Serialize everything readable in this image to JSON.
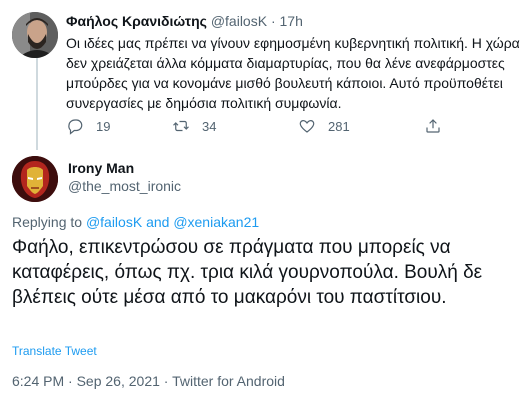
{
  "parent_tweet": {
    "author_name": "Φαήλος Κρανιδιώτης",
    "author_handle": "@failosK",
    "separator": "·",
    "time": "17h",
    "text": "Οι ιδέες μας πρέπει να γίνουν εφημοσμένη κυβερνητική πολιτική. Η χώρα δεν χρειάζεται άλλα κόμματα διαμαρτυρίας, που θα λένε ανεφάρμοστες μπούρδες για να κονομάνε μισθό βουλευτή κάποιοι. Αυτό προϋποθέτει συνεργασίες με δημόσια πολιτική συμφωνία.",
    "reply_count": "19",
    "retweet_count": "34",
    "like_count": "281"
  },
  "focused_tweet": {
    "author_name": "Irony Man",
    "author_handle": "@the_most_ironic",
    "replying_prefix": "Replying to",
    "replying_user_1": "@failosK",
    "replying_and": "and",
    "replying_user_2": "@xeniakan21",
    "text": "Φαήλο, επικεντρώσου σε πράγματα που μπορείς να καταφέρεις, όπως πχ. τρια κιλά γουρνοπούλα. Βουλή δε βλέπεις ούτε μέσα από το μακαρόνι του παστίτσιου.",
    "translate_label": "Translate Tweet",
    "time": "6:24 PM",
    "date": "Sep 26, 2021",
    "source": "Twitter for Android",
    "separator": "·"
  },
  "colors": {
    "text": "#0f1419",
    "secondary": "#536471",
    "link": "#1d9bf0",
    "thread_line": "#cfd9de"
  },
  "icons": {
    "reply": "reply-icon",
    "retweet": "retweet-icon",
    "like": "heart-icon",
    "share": "share-icon"
  }
}
